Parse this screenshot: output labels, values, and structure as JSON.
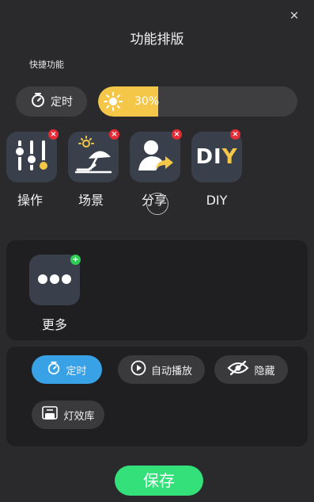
{
  "header": {
    "title": "功能排版",
    "close": "×"
  },
  "quick": {
    "section_label": "快捷功能",
    "timer_label": "定时",
    "brightness": {
      "value_text": "30%",
      "level_percent": 30
    }
  },
  "tiles": [
    {
      "label": "操作",
      "icon": "sliders-icon"
    },
    {
      "label": "场景",
      "icon": "beach-umbrella-icon"
    },
    {
      "label": "分享",
      "icon": "share-person-icon"
    },
    {
      "label": "DIY",
      "icon": "diy-icon",
      "icon_text_a": "DI",
      "icon_text_b": "Y"
    }
  ],
  "more": {
    "label": "更多",
    "icon": "ellipsis-icon"
  },
  "available": [
    {
      "label": "定时",
      "icon": "timer-icon",
      "active": true
    },
    {
      "label": "自动播放",
      "icon": "play-icon",
      "active": false
    },
    {
      "label": "隐藏",
      "icon": "eye-slash-icon",
      "active": false
    },
    {
      "label": "灯效库",
      "icon": "lamp-library-icon",
      "active": false
    }
  ],
  "save_label": "保存",
  "colors": {
    "accent_yellow": "#f4c748",
    "accent_blue": "#39a2e6",
    "save_green": "#34e07a",
    "remove_red": "#e52b35",
    "add_green": "#2ecc54"
  }
}
